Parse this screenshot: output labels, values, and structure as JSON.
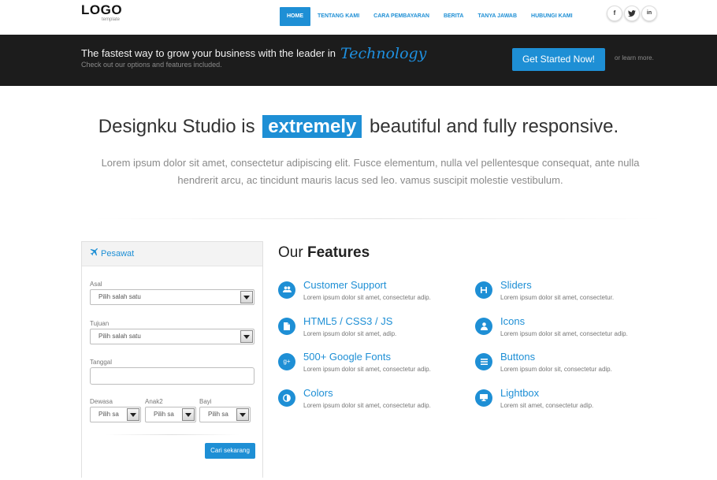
{
  "logo": {
    "text": "LOGO",
    "sub": "template"
  },
  "nav": {
    "items": [
      {
        "label": "HOME",
        "active": true
      },
      {
        "label": "TENTANG KAMI"
      },
      {
        "label": "CARA PEMBAYARAN"
      },
      {
        "label": "BERITA"
      },
      {
        "label": "TANYA JAWAB"
      },
      {
        "label": "HUBUNGI KAMI"
      }
    ]
  },
  "social": {
    "facebook": "f",
    "twitter": "t",
    "linkedin": "in"
  },
  "banner": {
    "title": "The fastest way to grow your business with the leader in",
    "accent": "Technology",
    "subtitle": "Check out our options and features included.",
    "cta": "Get Started Now!",
    "learn_more": "or learn more."
  },
  "hero": {
    "before": "Designku Studio is",
    "highlight": "extremely",
    "after": "beautiful and fully responsive.",
    "text": "Lorem ipsum dolor sit amet, consectetur adipiscing elit. Fusce elementum, nulla vel pellentesque consequat, ante nulla hendrerit arcu, ac tincidunt mauris lacus sed leo. vamus suscipit molestie vestibulum."
  },
  "form": {
    "title": "Pesawat",
    "asal_label": "Asal",
    "asal_value": "Pilih salah satu",
    "tujuan_label": "Tujuan",
    "tujuan_value": "Pilih salah satu",
    "tanggal_label": "Tanggal",
    "dewasa_label": "Dewasa",
    "dewasa_value": "Pilih sa",
    "anak_label": "Anak2",
    "anak_value": "Pilih sa",
    "bayi_label": "Bayi",
    "bayi_value": "Pilih sa",
    "submit": "Cari sekarang"
  },
  "features": {
    "title_light": "Our",
    "title_bold": "Features",
    "items": [
      {
        "title": "Customer Support",
        "desc": "Lorem ipsum dolor sit amet, consectetur adip.",
        "icon": "users-icon"
      },
      {
        "title": "Sliders",
        "desc": "Lorem ipsum dolor sit amet, consectetur.",
        "icon": "sliders-icon"
      },
      {
        "title": "HTML5 / CSS3 / JS",
        "desc": "Lorem ipsum dolor sit amet, adip.",
        "icon": "file-icon"
      },
      {
        "title": "Icons",
        "desc": "Lorem ipsum dolor sit amet, consectetur adip.",
        "icon": "user-icon"
      },
      {
        "title": "500+ Google Fonts",
        "desc": "Lorem ipsum dolor sit amet, consectetur adip.",
        "icon": "google-plus-icon"
      },
      {
        "title": "Buttons",
        "desc": "Lorem ipsum dolor sit, consectetur adip.",
        "icon": "list-icon"
      },
      {
        "title": "Colors",
        "desc": "Lorem ipsum dolor sit amet, consectetur adip.",
        "icon": "contrast-icon"
      },
      {
        "title": "Lightbox",
        "desc": "Lorem sit amet, consectetur adip.",
        "icon": "monitor-icon"
      }
    ]
  },
  "colors": {
    "accent": "#1e8fd5",
    "banner_bg": "#1c1c1c"
  }
}
